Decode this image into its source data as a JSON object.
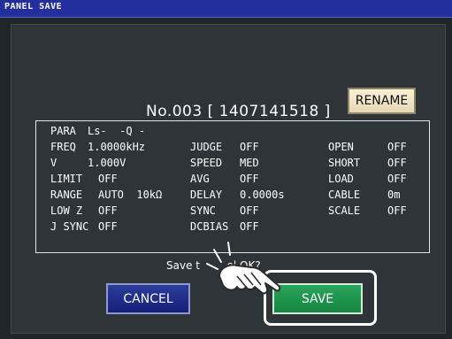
{
  "title": "PANEL SAVE",
  "panel": {
    "number": "No.003 [ 1407141518 ]",
    "rename_label": "RENAME"
  },
  "settings": {
    "para_label": "PARA",
    "para_value": "Ls-  -Q -",
    "freq_label": "FREQ",
    "freq_value": "1.0000kHz",
    "v_label": "V",
    "v_value": "1.000V",
    "limit_label": "LIMIT",
    "limit_value": "OFF",
    "range_label": "RANGE",
    "range_value": "AUTO  10kΩ",
    "lowz_label": "LOW Z",
    "lowz_value": "OFF",
    "jsync_label": "J SYNC",
    "jsync_value": "OFF",
    "judge_label": "JUDGE",
    "judge_value": "OFF",
    "speed_label": "SPEED",
    "speed_value": "MED",
    "avg_label": "AVG",
    "avg_value": "OFF",
    "delay_label": "DELAY",
    "delay_value": "0.0000s",
    "sync_label": "SYNC",
    "sync_value": "OFF",
    "dcbias_label": "DCBIAS",
    "dcbias_value": "OFF",
    "open_label": "OPEN",
    "open_value": "OFF",
    "short_label": "SHORT",
    "short_value": "OFF",
    "load_label": "LOAD",
    "load_value": "OFF",
    "cable_label": "CABLE",
    "cable_value": "0m",
    "scale_label": "SCALE",
    "scale_value": "OFF"
  },
  "prompt": "Save t        el OK?",
  "buttons": {
    "cancel_label": "CANCEL",
    "save_label": "SAVE"
  },
  "icons": {
    "pointer": "pointing-hand-icon"
  },
  "colors": {
    "title_bar": "#242f9e",
    "screen_bg": "#2f3438",
    "cancel_btn": "#1c2a8a",
    "save_btn": "#1e9650",
    "rename_btn": "#f2e5c4"
  }
}
